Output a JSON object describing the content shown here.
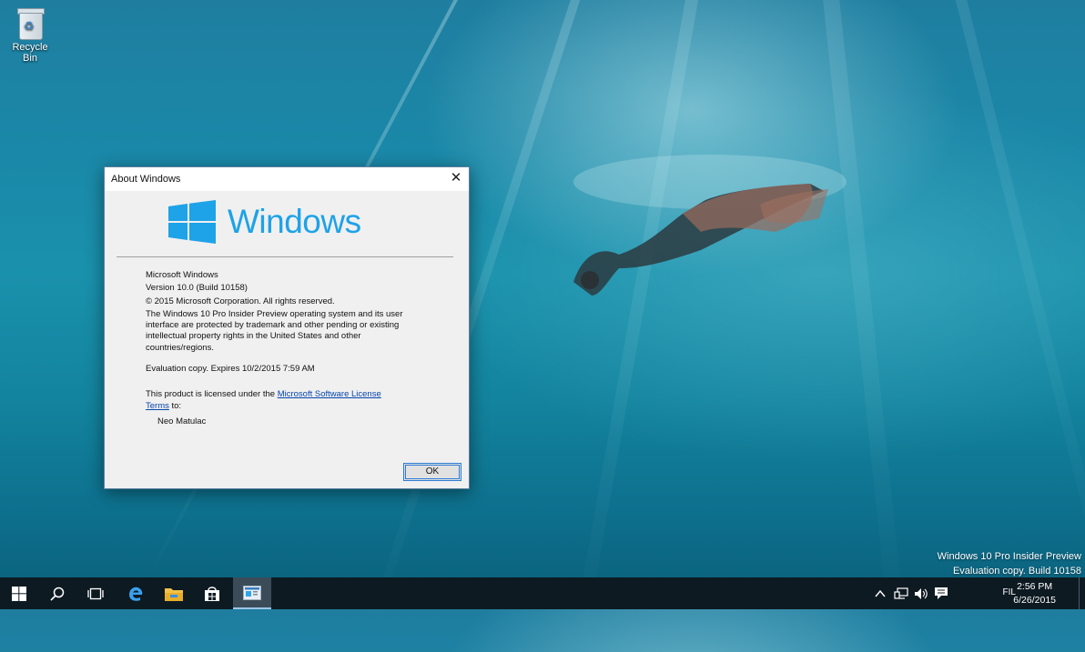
{
  "desktop": {
    "icons": [
      {
        "label": "Recycle Bin",
        "icon": "recycle-bin-icon"
      }
    ],
    "watermark": {
      "line1": "Windows 10 Pro Insider Preview",
      "line2": "Evaluation copy. Build 10158"
    }
  },
  "dialog": {
    "title": "About Windows",
    "close_glyph": "✕",
    "logo_text": "Windows",
    "product": "Microsoft Windows",
    "version": "Version 10.0 (Build 10158)",
    "copyright": "© 2015 Microsoft Corporation. All rights reserved.",
    "legal": [
      "The Windows 10 Pro Insider Preview operating system and its user",
      "interface are protected by trademark and other pending or existing",
      "intellectual property rights in the United States and other",
      "countries/regions."
    ],
    "evaluation": "Evaluation copy. Expires 10/2/2015 7:59 AM",
    "license_prefix": "This product is licensed under the ",
    "license_link_part1": "Microsoft Software License",
    "license_link_part2": "Terms",
    "license_suffix": " to:",
    "licensee": "Neo Matulac",
    "ok_label": "OK",
    "accent_color": "#1ea2e8"
  },
  "taskbar": {
    "items": [
      "start-icon",
      "search-icon",
      "task-view-icon",
      "edge-icon",
      "file-explorer-icon",
      "store-icon",
      "about-windows-app-icon"
    ],
    "tray": {
      "language": "FIL",
      "time": "2:56 PM",
      "date": "6/26/2015"
    }
  }
}
